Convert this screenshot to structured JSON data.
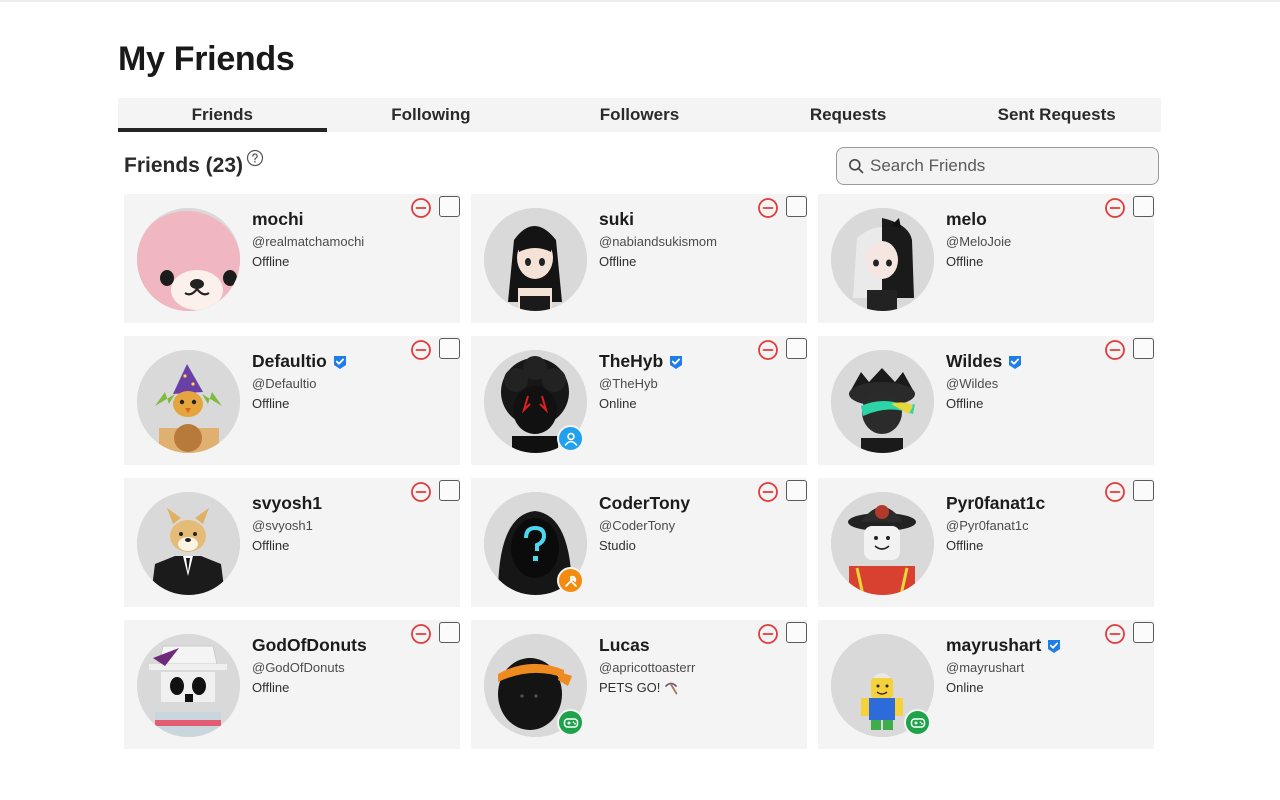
{
  "page": {
    "title": "My Friends"
  },
  "tabs": [
    {
      "label": "Friends",
      "active": true
    },
    {
      "label": "Following",
      "active": false
    },
    {
      "label": "Followers",
      "active": false
    },
    {
      "label": "Requests",
      "active": false
    },
    {
      "label": "Sent Requests",
      "active": false
    }
  ],
  "friends_section": {
    "heading": "Friends (23)",
    "help_icon": "question-circle-icon"
  },
  "search": {
    "placeholder": "Search Friends",
    "value": "",
    "icon": "search-icon"
  },
  "colors": {
    "remove_icon": "#e23b3b",
    "verified_badge": "#1f7de8",
    "presence_online": "#22a0f0",
    "presence_studio": "#f28b0f",
    "presence_game": "#1fa34a",
    "card_background": "#f4f4f4"
  },
  "friends": [
    {
      "name": "mochi",
      "handle": "@realmatchamochi",
      "status": "Offline",
      "verified": false,
      "presence": "none",
      "avatar": "pink-bear-avatar"
    },
    {
      "name": "suki",
      "handle": "@nabiandsukismom",
      "status": "Offline",
      "verified": false,
      "presence": "none",
      "avatar": "black-hair-girl-avatar"
    },
    {
      "name": "melo",
      "handle": "@MeloJoie",
      "status": "Offline",
      "verified": false,
      "presence": "none",
      "avatar": "split-hair-girl-avatar"
    },
    {
      "name": "Defaultio",
      "handle": "@Defaultio",
      "status": "Offline",
      "verified": true,
      "presence": "none",
      "avatar": "wizard-bird-avatar"
    },
    {
      "name": "TheHyb",
      "handle": "@TheHyb",
      "status": "Online",
      "verified": true,
      "presence": "online",
      "avatar": "dark-curly-avatar"
    },
    {
      "name": "Wildes",
      "handle": "@Wildes",
      "status": "Offline",
      "verified": true,
      "presence": "none",
      "avatar": "dark-helmet-avatar"
    },
    {
      "name": "svyosh1",
      "handle": "@svyosh1",
      "status": "Offline",
      "verified": false,
      "presence": "none",
      "avatar": "shiba-suit-avatar"
    },
    {
      "name": "CoderTony",
      "handle": "@CoderTony",
      "status": "Studio",
      "verified": false,
      "presence": "studio",
      "avatar": "hooded-question-avatar"
    },
    {
      "name": "Pyr0fanat1c",
      "handle": "@Pyr0fanat1c",
      "status": "Offline",
      "verified": false,
      "presence": "none",
      "avatar": "firefighter-avatar"
    },
    {
      "name": "GodOfDonuts",
      "handle": "@GodOfDonuts",
      "status": "Offline",
      "verified": false,
      "presence": "none",
      "avatar": "white-hat-avatar"
    },
    {
      "name": "Lucas",
      "handle": "@apricottoasterr",
      "status": "PETS GO!",
      "status_icon": "pickaxe-icon",
      "verified": false,
      "presence": "game",
      "avatar": "black-orange-band-avatar"
    },
    {
      "name": "mayrushart",
      "handle": "@mayrushart",
      "status": "Online",
      "verified": true,
      "presence": "game",
      "avatar": "blocky-noob-avatar"
    }
  ]
}
